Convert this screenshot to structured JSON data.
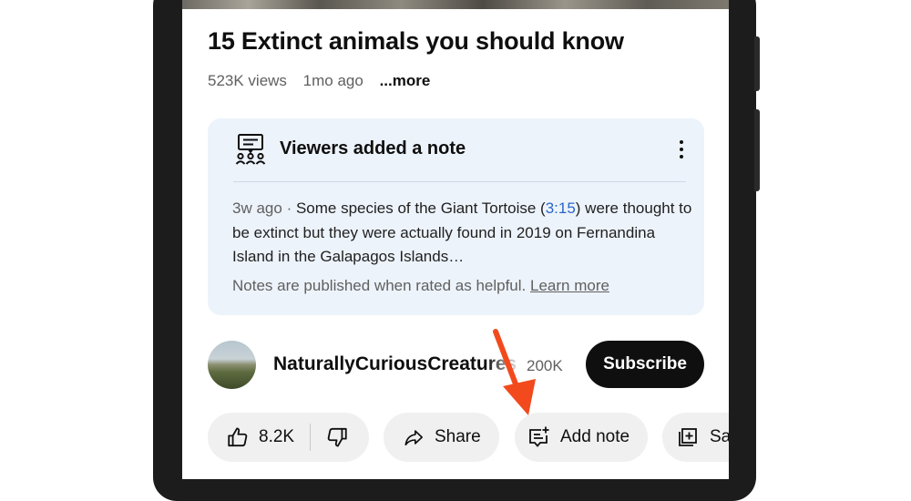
{
  "video": {
    "title": "15 Extinct animals you should know",
    "views": "523K views",
    "age": "1mo ago",
    "more_label": "...more"
  },
  "note": {
    "heading": "Viewers added a note",
    "age": "3w ago",
    "separator": "·",
    "text_before_timestamp": "Some species of the Giant Tortoise (",
    "timestamp": "3:15",
    "text_after_timestamp": ") were thought to be extinct but they were actually found in 2019 on Fernandina Island in the Galapagos Islands…",
    "footer_text": "Notes are published when rated as helpful.",
    "learn_more": "Learn more",
    "icons": {
      "note": "viewers-note-icon",
      "menu": "more-vert-icon"
    }
  },
  "channel": {
    "name": "NaturallyCuriousCreatures",
    "subscribers": "200K",
    "subscribe_label": "Subscribe"
  },
  "actions": {
    "likes": "8.2K",
    "share_label": "Share",
    "add_note_label": "Add note",
    "save_label": "Save",
    "icons": {
      "like": "thumb-up-icon",
      "dislike": "thumb-down-icon",
      "share": "share-arrow-icon",
      "add_note": "add-note-icon",
      "save": "save-playlist-icon"
    }
  },
  "annotation": {
    "arrow_color": "#f24a1d"
  },
  "colors": {
    "accent_link": "#2a66c9",
    "note_card_bg": "#edf3fb",
    "subscribe_bg": "#0f0f0f"
  }
}
